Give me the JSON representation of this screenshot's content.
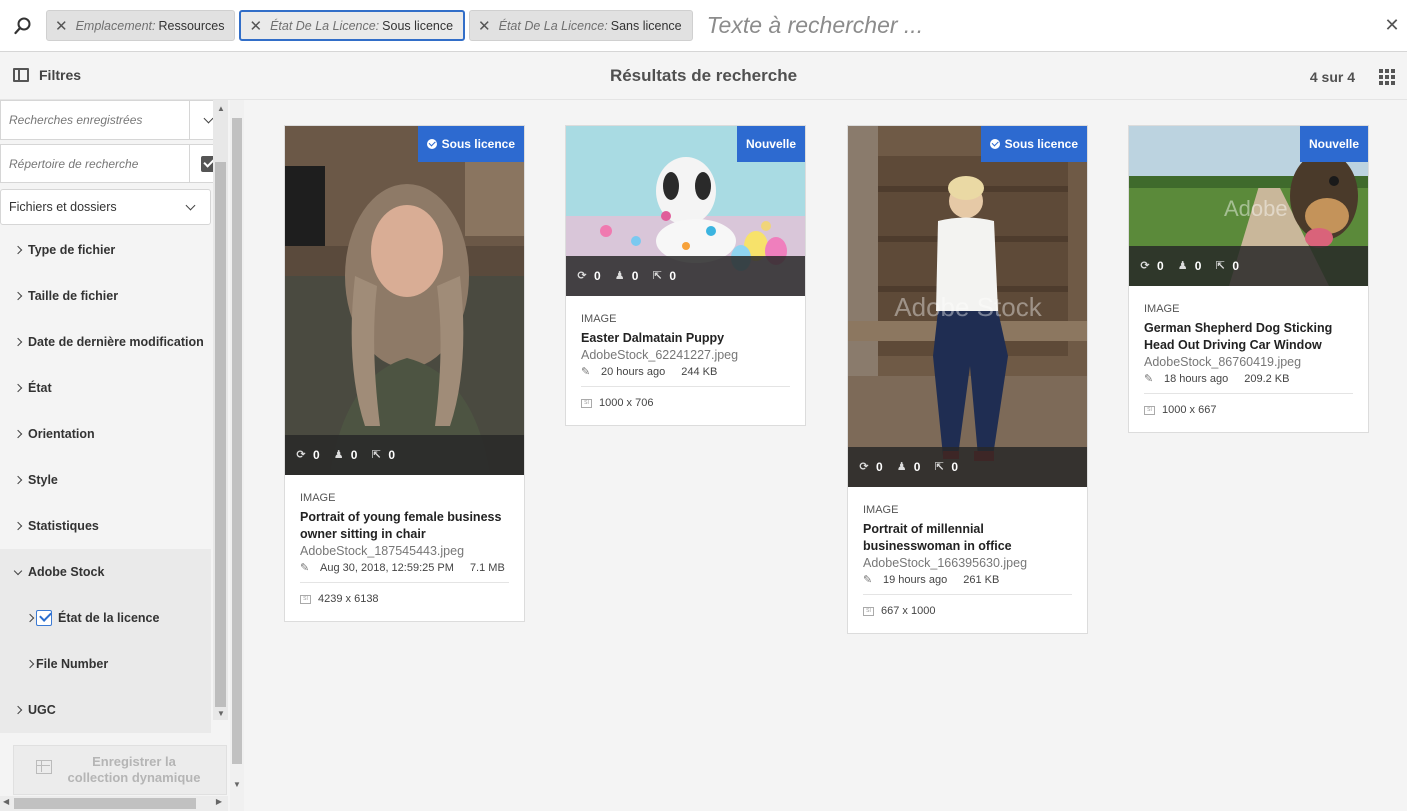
{
  "search": {
    "tags": [
      {
        "key": "Emplacement:",
        "value": "Ressources"
      },
      {
        "key": "État De La Licence:",
        "value": "Sous licence"
      },
      {
        "key": "État De La Licence:",
        "value": "Sans licence"
      }
    ],
    "placeholder": "Texte à rechercher ..."
  },
  "header": {
    "filters_label": "Filtres",
    "title": "Résultats de recherche",
    "count": "4 sur 4"
  },
  "sidebar": {
    "saved_searches": "Recherches enregistrées",
    "search_directory": "Répertoire de recherche",
    "files_folders": "Fichiers et dossiers",
    "facets": [
      "Type de fichier",
      "Taille de fichier",
      "Date de dernière modification",
      "État",
      "Orientation",
      "Style",
      "Statistiques",
      "Adobe Stock"
    ],
    "sub_facets": [
      "État de la licence",
      "File Number"
    ],
    "ugc": "UGC",
    "save_collection": "Enregistrer la collection dynamique"
  },
  "cards": [
    {
      "badge": "Sous licence",
      "stats": [
        "0",
        "0",
        "0"
      ],
      "type": "IMAGE",
      "title": "Portrait of young female business owner sitting in chair",
      "file": "AdobeStock_187545443.jpeg",
      "modified": "Aug 30, 2018, 12:59:25 PM",
      "size": "7.1 MB",
      "dims": "4239 x 6138"
    },
    {
      "badge": "Nouvelle",
      "stats": [
        "0",
        "0",
        "0"
      ],
      "type": "IMAGE",
      "title": "Easter Dalmatain Puppy",
      "file": "AdobeStock_62241227.jpeg",
      "modified": "20 hours ago",
      "size": "244 KB",
      "dims": "1000 x 706"
    },
    {
      "badge": "Sous licence",
      "stats": [
        "0",
        "0",
        "0"
      ],
      "type": "IMAGE",
      "title": "Portrait of millennial businesswoman in office",
      "file": "AdobeStock_166395630.jpeg",
      "modified": "19 hours ago",
      "size": "261 KB",
      "dims": "667 x 1000"
    },
    {
      "badge": "Nouvelle",
      "stats": [
        "0",
        "0",
        "0"
      ],
      "type": "IMAGE",
      "title": "German Shepherd Dog Sticking Head Out Driving Car Window",
      "file": "AdobeStock_86760419.jpeg",
      "modified": "18 hours ago",
      "size": "209.2 KB",
      "dims": "1000 x 667"
    }
  ],
  "watermark": "Adobe Stock"
}
